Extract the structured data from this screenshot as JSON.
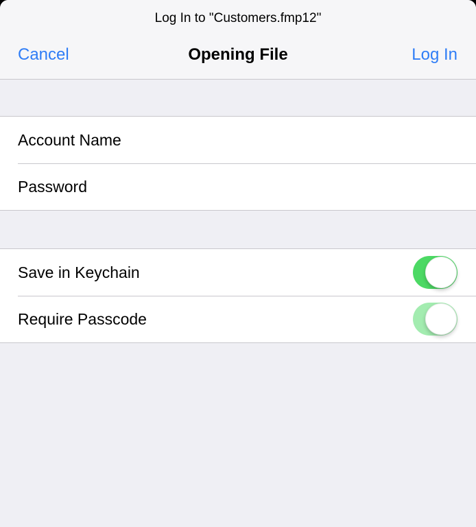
{
  "header": {
    "prompt": "Log In to \"Customers.fmp12\"",
    "title": "Opening File",
    "cancel_label": "Cancel",
    "login_label": "Log In"
  },
  "credentials": {
    "account_placeholder": "Account Name",
    "password_placeholder": "Password"
  },
  "options": [
    {
      "label": "Save in Keychain",
      "enabled": true,
      "state": "on"
    },
    {
      "label": "Require Passcode",
      "enabled": false,
      "state": "on"
    }
  ],
  "colors": {
    "accent": "#2f7df6",
    "toggle_on": "#4cd964",
    "toggle_disabled": "#a3ecb0",
    "background": "#efeff4"
  }
}
